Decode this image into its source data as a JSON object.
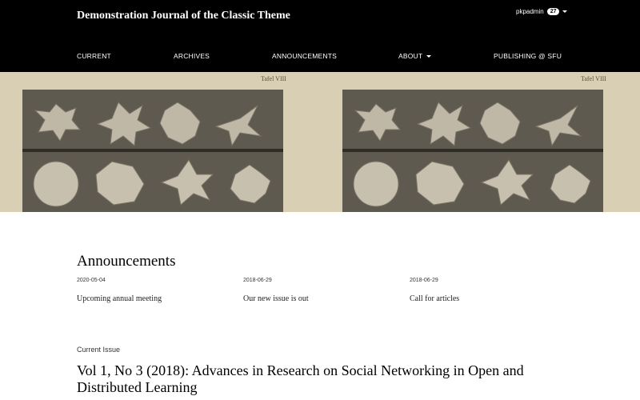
{
  "header": {
    "site_title": "Demonstration Journal of the Classic Theme",
    "user": {
      "name": "pkpadmin",
      "badge_count": "27"
    }
  },
  "nav": {
    "items": [
      {
        "label": "CURRENT"
      },
      {
        "label": "ARCHIVES"
      },
      {
        "label": "ANNOUNCEMENTS"
      },
      {
        "label": "ABOUT"
      },
      {
        "label": "PUBLISHING @ SFU"
      }
    ]
  },
  "hero": {
    "plate_label": "Tafel VIII"
  },
  "announcements": {
    "title": "Announcements",
    "items": [
      {
        "date": "2020-05-04",
        "title": "Upcoming annual meeting"
      },
      {
        "date": "2018-06-29",
        "title": "Our new issue is out"
      },
      {
        "date": "2018-06-29",
        "title": "Call for articles"
      }
    ]
  },
  "current_issue": {
    "label": "Current Issue",
    "title": "Vol 1, No 3 (2018): Advances in Research on Social Networking in Open and Distributed Learning"
  },
  "colors": {
    "header_bg": "#000000",
    "header_text": "#ffffff",
    "body_bg": "#ffffff"
  }
}
